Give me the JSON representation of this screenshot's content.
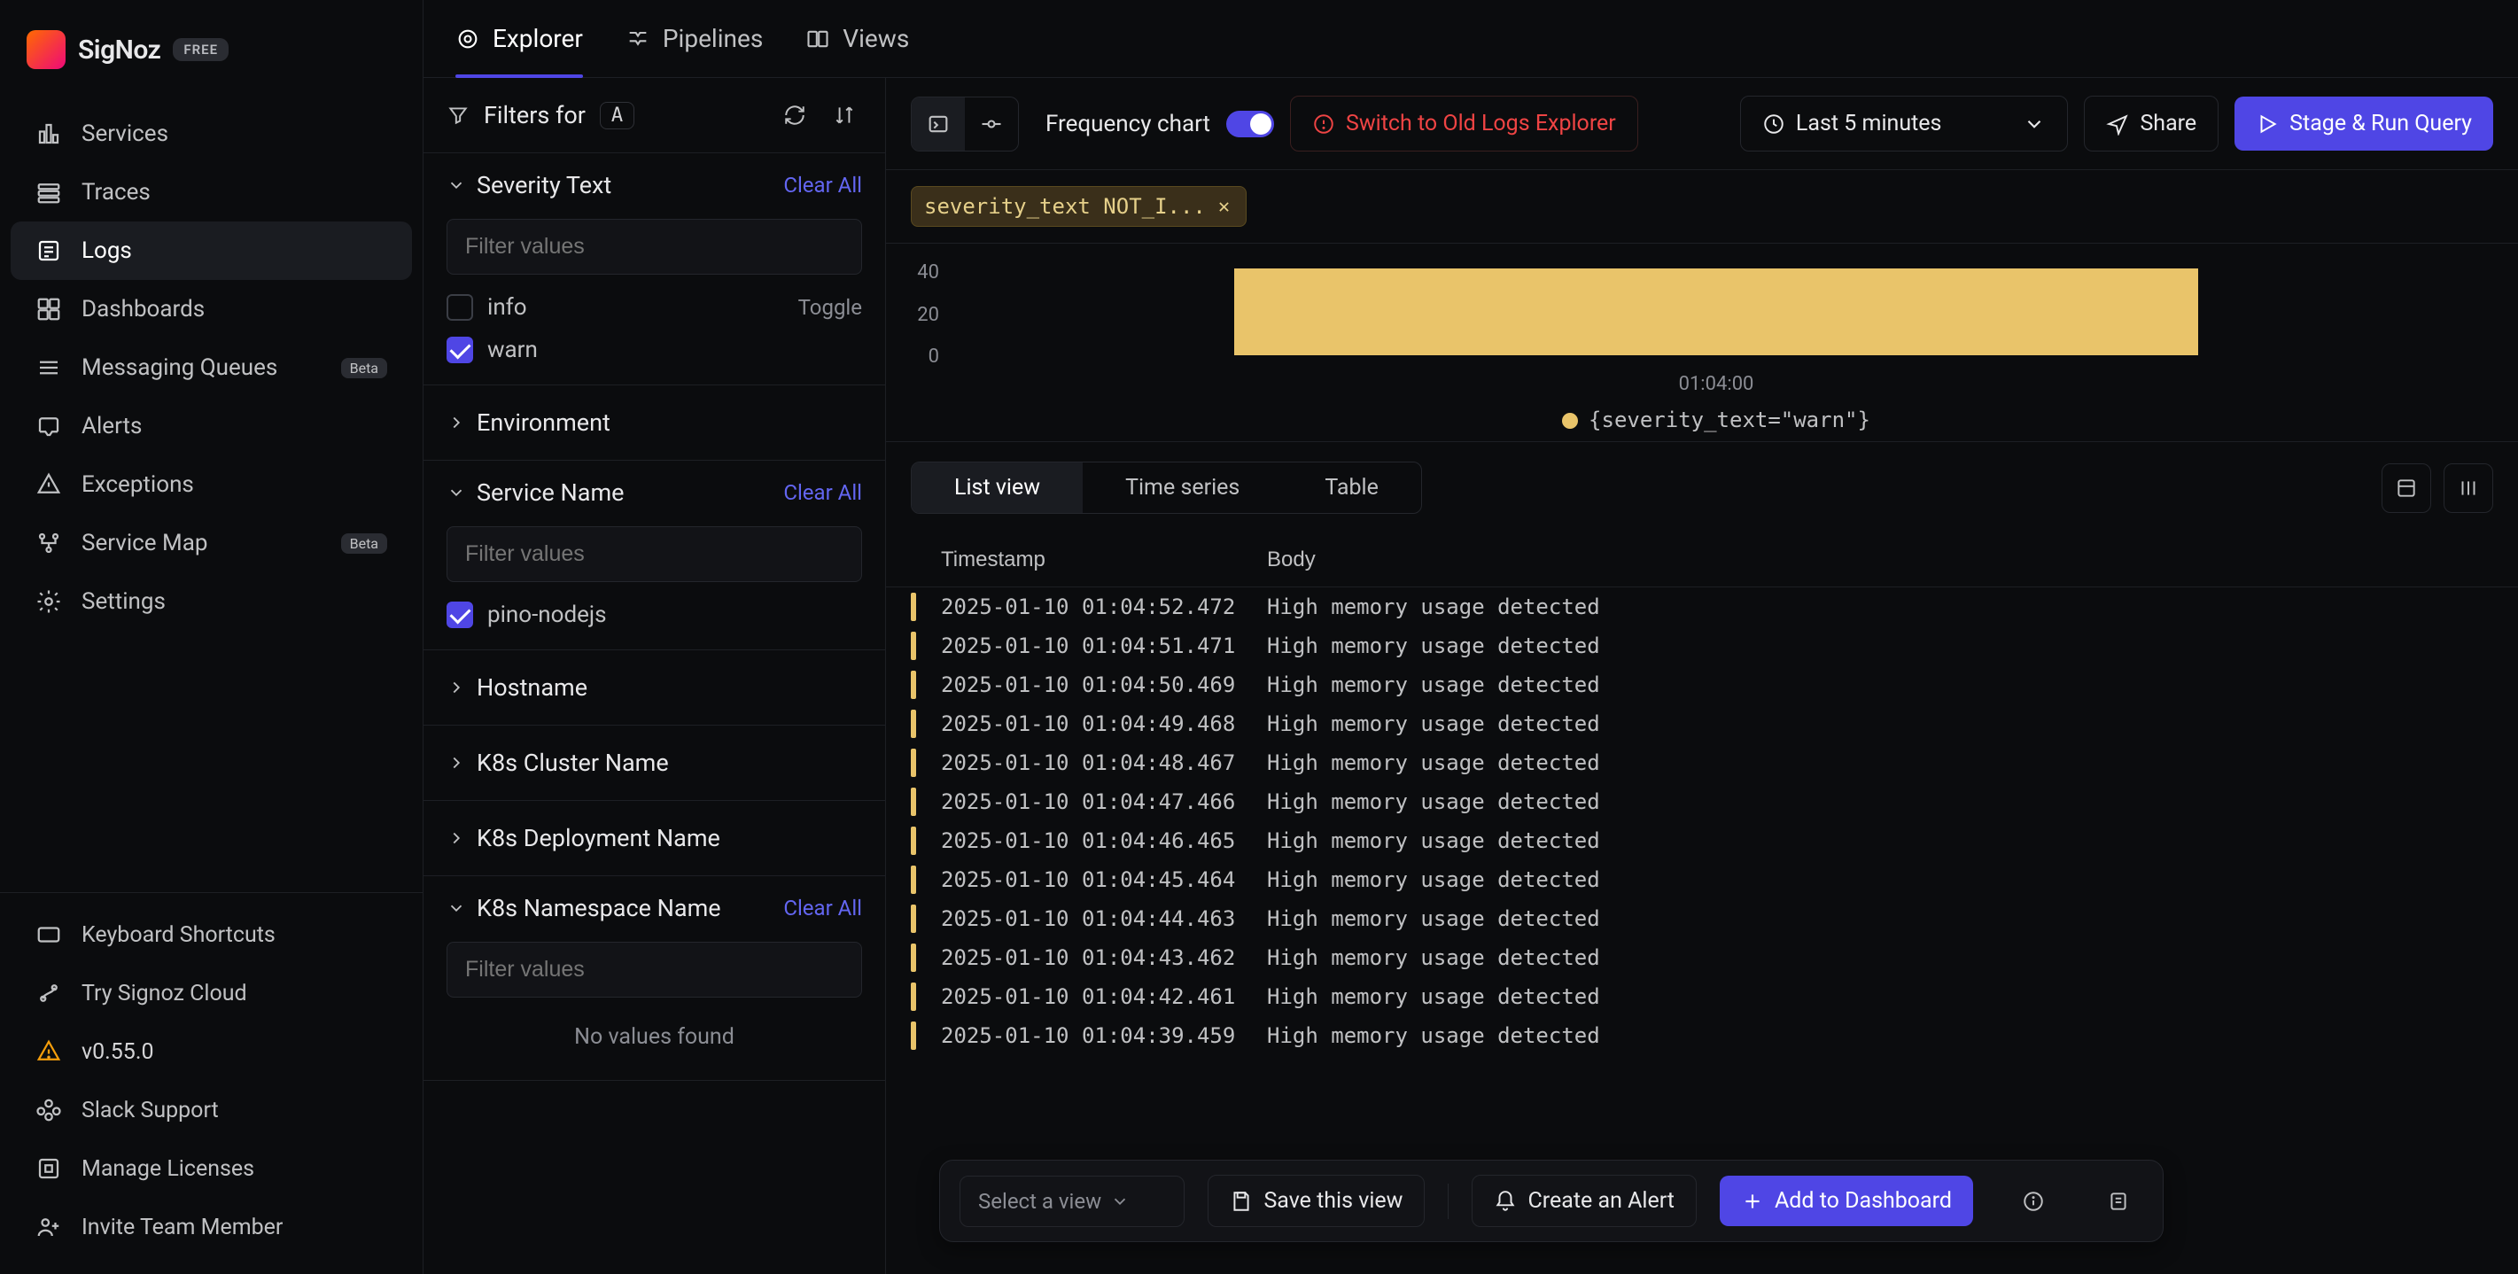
{
  "brand": {
    "name": "SigNoz",
    "badge_glyph": "",
    "tier": "FREE"
  },
  "nav": {
    "items": [
      {
        "label": "Services"
      },
      {
        "label": "Traces"
      },
      {
        "label": "Logs",
        "active": true
      },
      {
        "label": "Dashboards"
      },
      {
        "label": "Messaging Queues",
        "beta": true
      },
      {
        "label": "Alerts"
      },
      {
        "label": "Exceptions"
      },
      {
        "label": "Service Map",
        "beta": true
      },
      {
        "label": "Settings"
      }
    ],
    "bottom": [
      {
        "label": "Keyboard Shortcuts"
      },
      {
        "label": "Try Signoz Cloud"
      },
      {
        "label": "v0.55.0",
        "version_row": true
      },
      {
        "label": "Slack Support"
      },
      {
        "label": "Manage Licenses"
      },
      {
        "label": "Invite Team Member"
      }
    ]
  },
  "top_tabs": [
    {
      "label": "Explorer",
      "active": true
    },
    {
      "label": "Pipelines"
    },
    {
      "label": "Views"
    }
  ],
  "filters_header": {
    "label": "Filters for",
    "key": "A"
  },
  "facets": {
    "severity_text": {
      "title": "Severity Text",
      "clear": "Clear All",
      "placeholder": "Filter values",
      "options": [
        {
          "label": "info",
          "checked": false,
          "rhs": "Toggle"
        },
        {
          "label": "warn",
          "checked": true
        }
      ]
    },
    "environment": {
      "title": "Environment"
    },
    "service_name": {
      "title": "Service Name",
      "clear": "Clear All",
      "placeholder": "Filter values",
      "options": [
        {
          "label": "pino-nodejs",
          "checked": true
        }
      ]
    },
    "hostname": {
      "title": "Hostname"
    },
    "k8s_cluster": {
      "title": "K8s Cluster Name"
    },
    "k8s_deployment": {
      "title": "K8s Deployment Name"
    },
    "k8s_namespace": {
      "title": "K8s Namespace Name",
      "clear": "Clear All",
      "placeholder": "Filter values",
      "no_values": "No values found"
    }
  },
  "query_bar": {
    "frequency_label": "Frequency chart",
    "frequency_on": true,
    "switch_old": "Switch to Old Logs Explorer",
    "time_label": "Last 5 minutes",
    "share": "Share",
    "run": "Stage & Run Query"
  },
  "filter_chip": {
    "text": "severity_text NOT_I..."
  },
  "chart_data": {
    "type": "bar",
    "y_ticks": [
      "40",
      "20",
      "0"
    ],
    "categories": [
      "01:04:00"
    ],
    "values": [
      40
    ],
    "ylim": [
      0,
      40
    ],
    "legend": "{severity_text=\"warn\"}",
    "series_color": "#e9c46a"
  },
  "view_tabs": [
    {
      "label": "List view",
      "active": true
    },
    {
      "label": "Time series"
    },
    {
      "label": "Table"
    }
  ],
  "table": {
    "headers": {
      "ts": "Timestamp",
      "body": "Body"
    },
    "rows": [
      {
        "ts": "2025-01-10 01:04:52.472",
        "body": "High memory usage detected"
      },
      {
        "ts": "2025-01-10 01:04:51.471",
        "body": "High memory usage detected"
      },
      {
        "ts": "2025-01-10 01:04:50.469",
        "body": "High memory usage detected"
      },
      {
        "ts": "2025-01-10 01:04:49.468",
        "body": "High memory usage detected"
      },
      {
        "ts": "2025-01-10 01:04:48.467",
        "body": "High memory usage detected"
      },
      {
        "ts": "2025-01-10 01:04:47.466",
        "body": "High memory usage detected"
      },
      {
        "ts": "2025-01-10 01:04:46.465",
        "body": "High memory usage detected"
      },
      {
        "ts": "2025-01-10 01:04:45.464",
        "body": "High memory usage detected"
      },
      {
        "ts": "2025-01-10 01:04:44.463",
        "body": "High memory usage detected"
      },
      {
        "ts": "2025-01-10 01:04:43.462",
        "body": "High memory usage detected"
      },
      {
        "ts": "2025-01-10 01:04:42.461",
        "body": "High memory usage detected"
      },
      {
        "ts": "2025-01-10 01:04:39.459",
        "body": "High memory usage detected"
      }
    ]
  },
  "floatbar": {
    "select_placeholder": "Select a view",
    "save": "Save this view",
    "alert": "Create an Alert",
    "dashboard": "Add to Dashboard"
  }
}
